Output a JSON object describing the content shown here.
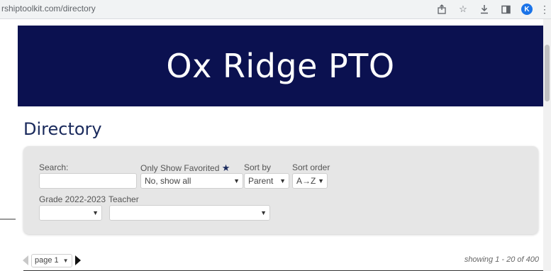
{
  "browser": {
    "url": "rshiptoolkit.com/directory",
    "avatar_letter": "K",
    "icons": [
      "share-icon",
      "star-icon",
      "download-icon",
      "sidepanel-icon",
      "avatar",
      "more-icon"
    ]
  },
  "header": {
    "title": "Ox Ridge PTO"
  },
  "page": {
    "heading": "Directory"
  },
  "filters": {
    "search": {
      "label": "Search:",
      "value": ""
    },
    "favorited": {
      "label": "Only Show Favorited",
      "value": "No, show all"
    },
    "sort_by": {
      "label": "Sort by",
      "value": "Parent"
    },
    "sort_order": {
      "label": "Sort order",
      "value": "A→Z"
    },
    "grade": {
      "label": "Grade 2022-2023",
      "value": ""
    },
    "teacher": {
      "label": "Teacher",
      "value": ""
    }
  },
  "pager": {
    "page_label": "page 1",
    "showing": "showing 1 - 20 of 400"
  },
  "colors": {
    "banner": "#0b1150",
    "heading": "#1a2a5c",
    "panel": "#e6e6e6"
  }
}
